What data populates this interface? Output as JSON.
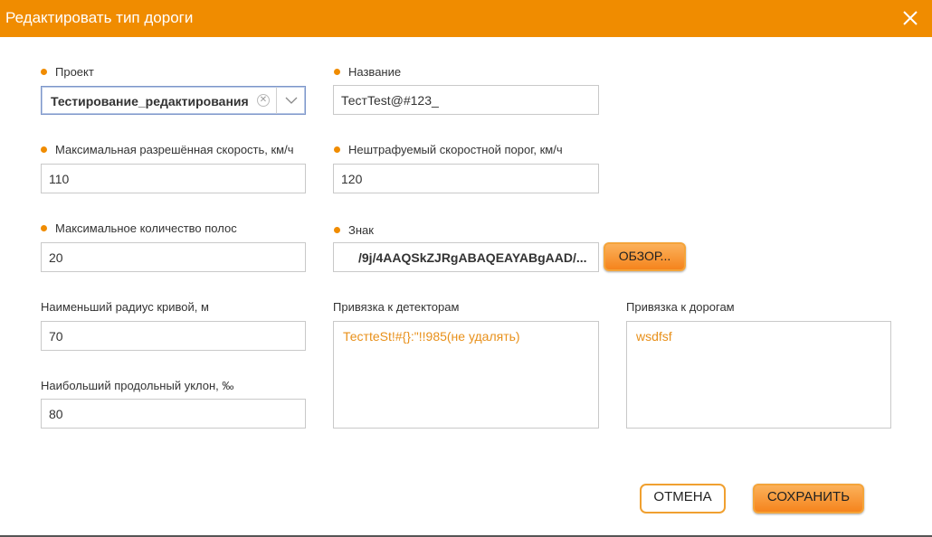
{
  "dialog": {
    "title": "Редактировать тип дороги",
    "close_icon": "close-icon"
  },
  "colors": {
    "accent": "#f08c00",
    "link_text": "#e8901a"
  },
  "fields": {
    "project": {
      "label": "Проект",
      "value": "Тестирование_редактирования",
      "required": true
    },
    "name": {
      "label": "Название",
      "value": "ТестTest@#123_",
      "required": true
    },
    "max_speed": {
      "label": "Максимальная разрешённая скорость, км/ч",
      "value": "110",
      "required": true
    },
    "speed_threshold": {
      "label": "Нештрафуемый скоростной порог, км/ч",
      "value": "120",
      "required": true
    },
    "max_lanes": {
      "label": "Максимальное количество полос",
      "value": "20",
      "required": true
    },
    "sign": {
      "label": "Знак",
      "value": "/9j/4AAQSkZJRgABAQEAYABgAAD/...",
      "required": true
    },
    "min_radius": {
      "label": "Наименьший радиус кривой, м",
      "value": "70",
      "required": false
    },
    "max_slope": {
      "label": "Наибольший продольный уклон, ‰",
      "value": "80",
      "required": false
    },
    "detectors": {
      "label": "Привязка к детекторам",
      "value": "ТестteSt!#{}:\"!!985(не удалять)"
    },
    "roads": {
      "label": "Привязка к дорогам",
      "value": "wsdfsf"
    }
  },
  "buttons": {
    "browse": "ОБЗОР...",
    "cancel": "ОТМЕНА",
    "save": "СОХРАНИТЬ"
  }
}
